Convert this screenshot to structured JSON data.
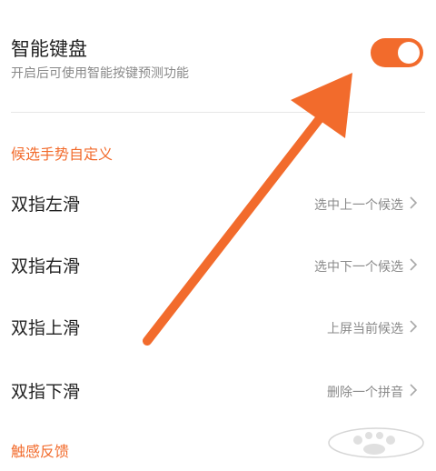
{
  "smart_keyboard": {
    "title": "智能键盘",
    "subtitle": "开启后可使用智能按键预测功能",
    "enabled": true
  },
  "section_gesture": {
    "header": "候选手势自定义",
    "items": [
      {
        "label": "双指左滑",
        "value": "选中上一个候选"
      },
      {
        "label": "双指右滑",
        "value": "选中下一个候选"
      },
      {
        "label": "双指上滑",
        "value": "上屏当前候选"
      },
      {
        "label": "双指下滑",
        "value": "删除一个拼音"
      }
    ]
  },
  "section_haptic": {
    "header": "触感反馈"
  },
  "colors": {
    "accent": "#f26b2c",
    "title": "#1f1f1f",
    "secondary": "#8a8a8a"
  }
}
